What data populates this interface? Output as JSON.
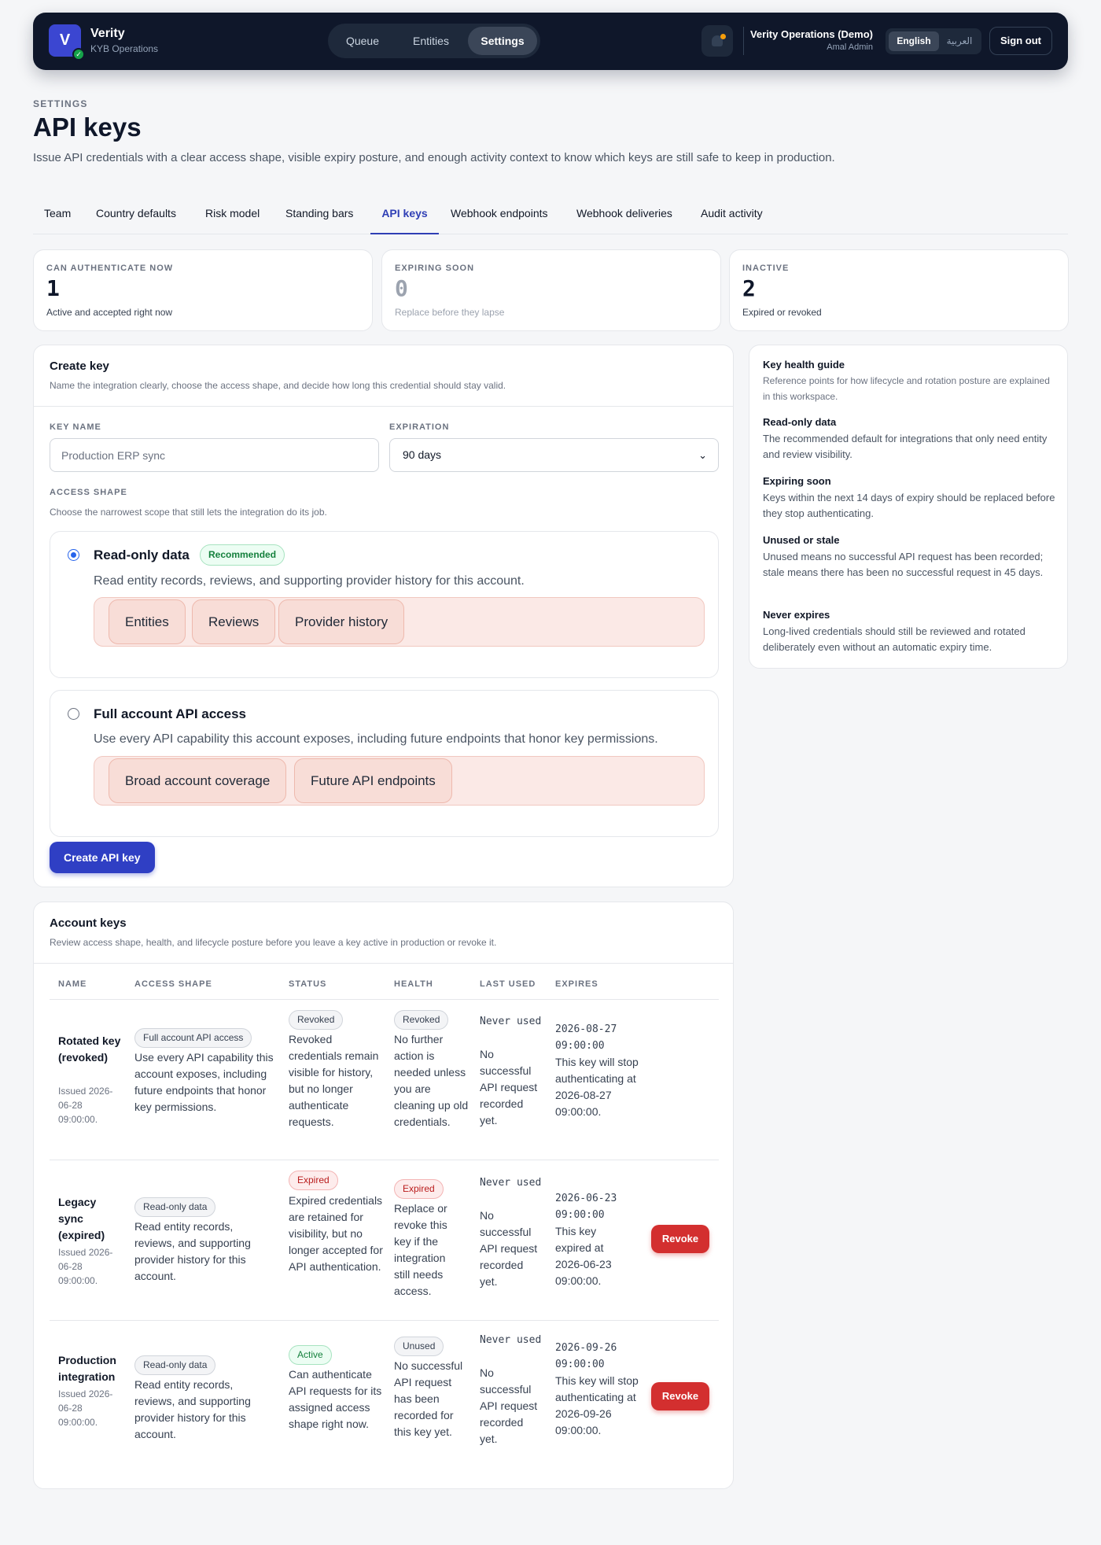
{
  "app": {
    "logo_letter": "V",
    "name": "Verity",
    "subtitle": "KYB Operations"
  },
  "nav": [
    {
      "label": "Queue"
    },
    {
      "label": "Entities"
    },
    {
      "label": "Settings",
      "active": true
    }
  ],
  "account": {
    "org": "Verity Operations (Demo)",
    "user": "Amal Admin"
  },
  "languages": [
    {
      "label": "English",
      "active": true
    },
    {
      "label": "العربية"
    }
  ],
  "signout_label": "Sign out",
  "header": {
    "eyebrow": "SETTINGS",
    "title": "API keys",
    "description": "Issue API credentials with a clear access shape, visible expiry posture, and enough activity context to know which keys are still safe to keep in production."
  },
  "tabs": [
    {
      "label": "Team"
    },
    {
      "label": "Country defaults"
    },
    {
      "label": "Risk model"
    },
    {
      "label": "Standing bars"
    },
    {
      "label": "API keys",
      "active": true
    },
    {
      "label": "Webhook endpoints"
    },
    {
      "label": "Webhook deliveries"
    },
    {
      "label": "Audit activity"
    }
  ],
  "stats": [
    {
      "label": "CAN AUTHENTICATE NOW",
      "value": "1",
      "sub": "Active and accepted right now"
    },
    {
      "label": "EXPIRING SOON",
      "value": "0",
      "sub": "Replace before they lapse"
    },
    {
      "label": "INACTIVE",
      "value": "2",
      "sub": "Expired or revoked"
    }
  ],
  "create": {
    "title": "Create key",
    "subtitle": "Name the integration clearly, choose the access shape, and decide how long this credential should stay valid.",
    "key_name_label": "KEY NAME",
    "key_name_placeholder": "Production ERP sync",
    "expiration_label": "EXPIRATION",
    "expiration_value": "90 days",
    "access_label": "ACCESS SHAPE",
    "access_help": "Choose the narrowest scope that still lets the integration do its job.",
    "options": [
      {
        "title": "Read-only data",
        "badge": "Recommended",
        "selected": true,
        "desc": "Read entity records, reviews, and supporting provider history for this account.",
        "chips": [
          "Entities",
          "Reviews",
          "Provider history"
        ]
      },
      {
        "title": "Full account API access",
        "selected": false,
        "desc": "Use every API capability this account exposes, including future endpoints that honor key permissions.",
        "chips": [
          "Broad account coverage",
          "Future API endpoints"
        ]
      }
    ],
    "submit_label": "Create API key"
  },
  "guide": {
    "title": "Key health guide",
    "subtitle": "Reference points for how lifecycle and rotation posture are explained in this workspace.",
    "items": [
      {
        "title": "Read-only data",
        "body": "The recommended default for integrations that only need entity and review visibility."
      },
      {
        "title": "Expiring soon",
        "body": "Keys within the next 14 days of expiry should be replaced before they stop authenticating."
      },
      {
        "title": "Unused or stale",
        "body": "Unused means no successful API request has been recorded; stale means there has been no successful request in 45 days."
      },
      {
        "title": "Never expires",
        "body": "Long-lived credentials should still be reviewed and rotated deliberately even without an automatic expiry time."
      }
    ]
  },
  "keys": {
    "title": "Account keys",
    "subtitle": "Review access shape, health, and lifecycle posture before you leave a key active in production or revoke it.",
    "columns": [
      "NAME",
      "ACCESS SHAPE",
      "STATUS",
      "HEALTH",
      "LAST USED",
      "EXPIRES"
    ],
    "revoke_label": "Revoke",
    "rows": [
      {
        "name": "Rotated key (revoked)",
        "issued": "Issued 2026-06-28 09:00:00.",
        "access_pill": "Full account API access",
        "access_desc": "Use every API capability this account exposes, including future endpoints that honor key permissions.",
        "status_pill": "Revoked",
        "status_desc": "Revoked credentials remain visible for history, but no longer authenticate requests.",
        "health_pill": "Revoked",
        "health_desc": "No further action is needed unless you are cleaning up old credentials.",
        "last_used": "Never used",
        "last_used_desc": "No successful API request recorded yet.",
        "expires": "2026-08-27 09:00:00",
        "expires_desc": "This key will stop authenticating at 2026-08-27 09:00:00."
      },
      {
        "name": "Legacy sync (expired)",
        "issued": "Issued 2026-06-28 09:00:00.",
        "access_pill": "Read-only data",
        "access_desc": "Read entity records, reviews, and supporting provider history for this account.",
        "status_pill": "Expired",
        "status_desc": "Expired credentials are retained for visibility, but no longer accepted for API authentication.",
        "health_pill": "Expired",
        "health_desc": "Replace or revoke this key if the integration still needs access.",
        "last_used": "Never used",
        "last_used_desc": "No successful API request recorded yet.",
        "expires": "2026-06-23 09:00:00",
        "expires_desc": "This key expired at 2026-06-23 09:00:00."
      },
      {
        "name": "Production integration",
        "issued": "Issued 2026-06-28 09:00:00.",
        "access_pill": "Read-only data",
        "access_desc": "Read entity records, reviews, and supporting provider history for this account.",
        "status_pill": "Active",
        "status_desc": "Can authenticate API requests for its assigned access shape right now.",
        "health_pill": "Unused",
        "health_desc": "No successful API request has been recorded for this key yet.",
        "last_used": "Never used",
        "last_used_desc": "No successful API request recorded yet.",
        "expires": "2026-09-26 09:00:00",
        "expires_desc": "This key will stop authenticating at 2026-09-26 09:00:00."
      }
    ]
  }
}
